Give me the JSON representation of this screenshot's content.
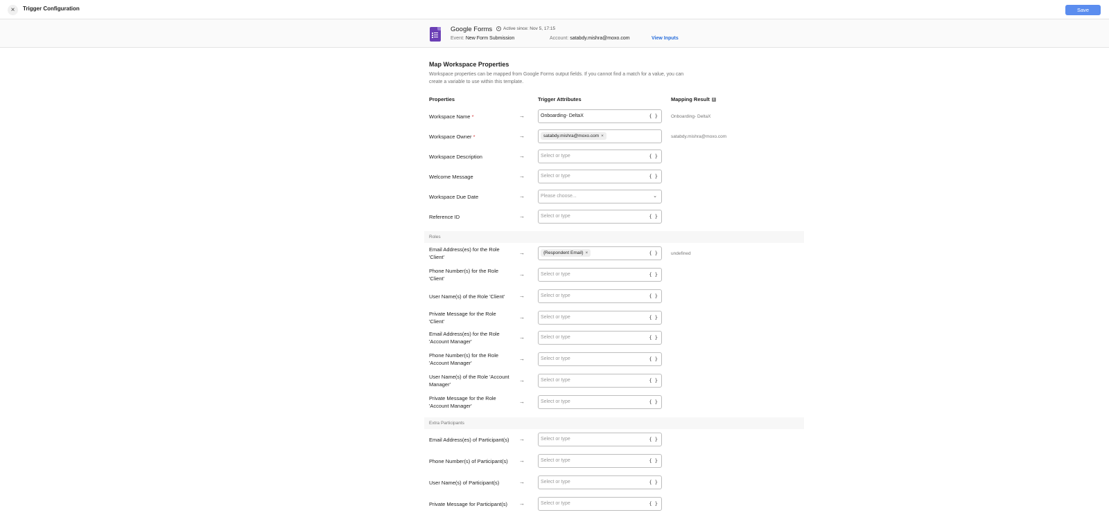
{
  "header": {
    "close_glyph": "×",
    "title": "Trigger Configuration",
    "save_label": "Save"
  },
  "trigger": {
    "app_name": "Google Forms",
    "icon": "google-forms-icon",
    "active_since": "Active since: Nov 5, 17:15",
    "event_label": "Event:",
    "event_value": "New Form Submission",
    "account_label": "Account:",
    "account_value": "satabdy.mishra@moxo.com",
    "view_inputs": "View Inputs"
  },
  "section": {
    "title": "Map Workspace Properties",
    "description": "Workspace properties can be mapped from Google Forms output fields. If you cannot find a match for a value, you can create a variable to use within this template."
  },
  "columns": {
    "properties": "Properties",
    "trigger_attributes": "Trigger Attributes",
    "mapping_result": "Mapping Result"
  },
  "symbols": {
    "arrow": "→",
    "brace": "{ }",
    "chevron": "⌄",
    "chip_remove": "×",
    "required": "*"
  },
  "rows": [
    {
      "label": "Workspace Name",
      "value": "Onboarding- DeltaX",
      "result": "Onboarding- DeltaX"
    },
    {
      "label": "Workspace Owner",
      "chip": "satabdy.mishra@moxo.com",
      "result": "satabdy.mishra@moxo.com"
    },
    {
      "label": "Workspace Description",
      "placeholder": "Select or type"
    },
    {
      "label": "Welcome Message",
      "placeholder": "Select or type"
    },
    {
      "label": "Workspace Due Date",
      "placeholder": "Please choose..."
    },
    {
      "label": "Reference ID",
      "placeholder": "Select or type"
    }
  ],
  "roles": {
    "heading": "Roles",
    "rows": [
      {
        "label": "Email Address(es) for the Role 'Client'",
        "chip": "{Respondent Email}",
        "result": "undefined"
      },
      {
        "label": "Phone Number(s) for the Role 'Client'",
        "placeholder": "Select or type"
      },
      {
        "label": "User Name(s) of the Role 'Client'",
        "placeholder": "Select or type"
      },
      {
        "label": "Private Message for the Role 'Client'",
        "placeholder": "Select or type"
      },
      {
        "label": "Email Address(es) for the Role 'Account Manager'",
        "placeholder": "Select or type"
      },
      {
        "label": "Phone Number(s) for the Role 'Account Manager'",
        "placeholder": "Select or type"
      },
      {
        "label": "User Name(s) of the Role 'Account Manager'",
        "placeholder": "Select or type"
      },
      {
        "label": "Private Message for the Role 'Account Manager'",
        "placeholder": "Select or type"
      }
    ]
  },
  "extra": {
    "heading": "Extra Participants",
    "rows": [
      {
        "label": "Email Address(es) of Participant(s)",
        "placeholder": "Select or type"
      },
      {
        "label": "Phone Number(s) of Participant(s)",
        "placeholder": "Select or type"
      },
      {
        "label": "User Name(s) of Participant(s)",
        "placeholder": "Select or type"
      },
      {
        "label": "Private Message for Participant(s)",
        "placeholder": "Select or type"
      }
    ]
  }
}
